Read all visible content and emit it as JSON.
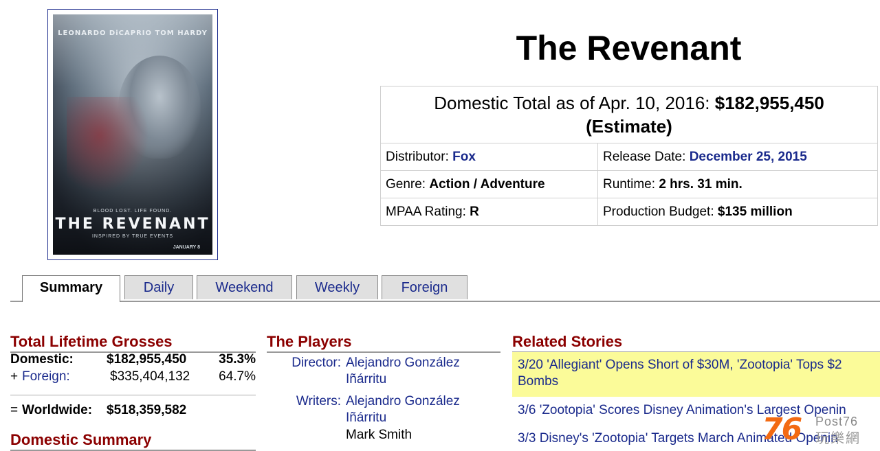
{
  "poster": {
    "actors": "LEONARDO DiCAPRIO   TOM HARDY",
    "tagline": "BLOOD LOST. LIFE FOUND.",
    "title": "THE REVENANT",
    "subtitle": "INSPIRED BY TRUE EVENTS",
    "date": "JANUARY 8"
  },
  "movie": {
    "title": "The Revenant",
    "domestic_label": "Domestic Total as of Apr. 10, 2016:",
    "domestic_total": "$182,955,450",
    "estimate": "(Estimate)",
    "distributor_label": "Distributor:",
    "distributor": "Fox",
    "release_label": "Release Date:",
    "release_date": "December 25, 2015",
    "genre_label": "Genre:",
    "genre": "Action / Adventure",
    "runtime_label": "Runtime:",
    "runtime": "2 hrs. 31 min.",
    "mpaa_label": "MPAA Rating:",
    "mpaa": "R",
    "budget_label": "Production Budget:",
    "budget": "$135 million"
  },
  "tabs": [
    "Summary",
    "Daily",
    "Weekend",
    "Weekly",
    "Foreign"
  ],
  "grosses": {
    "heading": "Total Lifetime Grosses",
    "domestic_label": "Domestic:",
    "domestic_value": "$182,955,450",
    "domestic_pct": "35.3%",
    "foreign_prefix": "+",
    "foreign_label": "Foreign:",
    "foreign_value": "$335,404,132",
    "foreign_pct": "64.7%",
    "worldwide_prefix": "=",
    "worldwide_label": "Worldwide:",
    "worldwide_value": "$518,359,582"
  },
  "domestic_summary": {
    "heading": "Domestic Summary"
  },
  "players": {
    "heading": "The Players",
    "director_label": "Director:",
    "director_line1": "Alejandro González",
    "director_line2": "Iñárritu",
    "writers_label": "Writers:",
    "writer1_line1": "Alejandro González",
    "writer1_line2": "Iñárritu",
    "writer2": "Mark Smith"
  },
  "stories": {
    "heading": "Related Stories",
    "items": [
      "3/20 'Allegiant' Opens Short of $30M, 'Zootopia' Tops $2",
      "Bombs",
      "3/6 'Zootopia' Scores Disney Animation's Largest Openin",
      "3/3 Disney's 'Zootopia' Targets March Animated Openin"
    ]
  },
  "watermark": {
    "number": "76",
    "post": "Post76",
    "cn": "玩樂網"
  }
}
